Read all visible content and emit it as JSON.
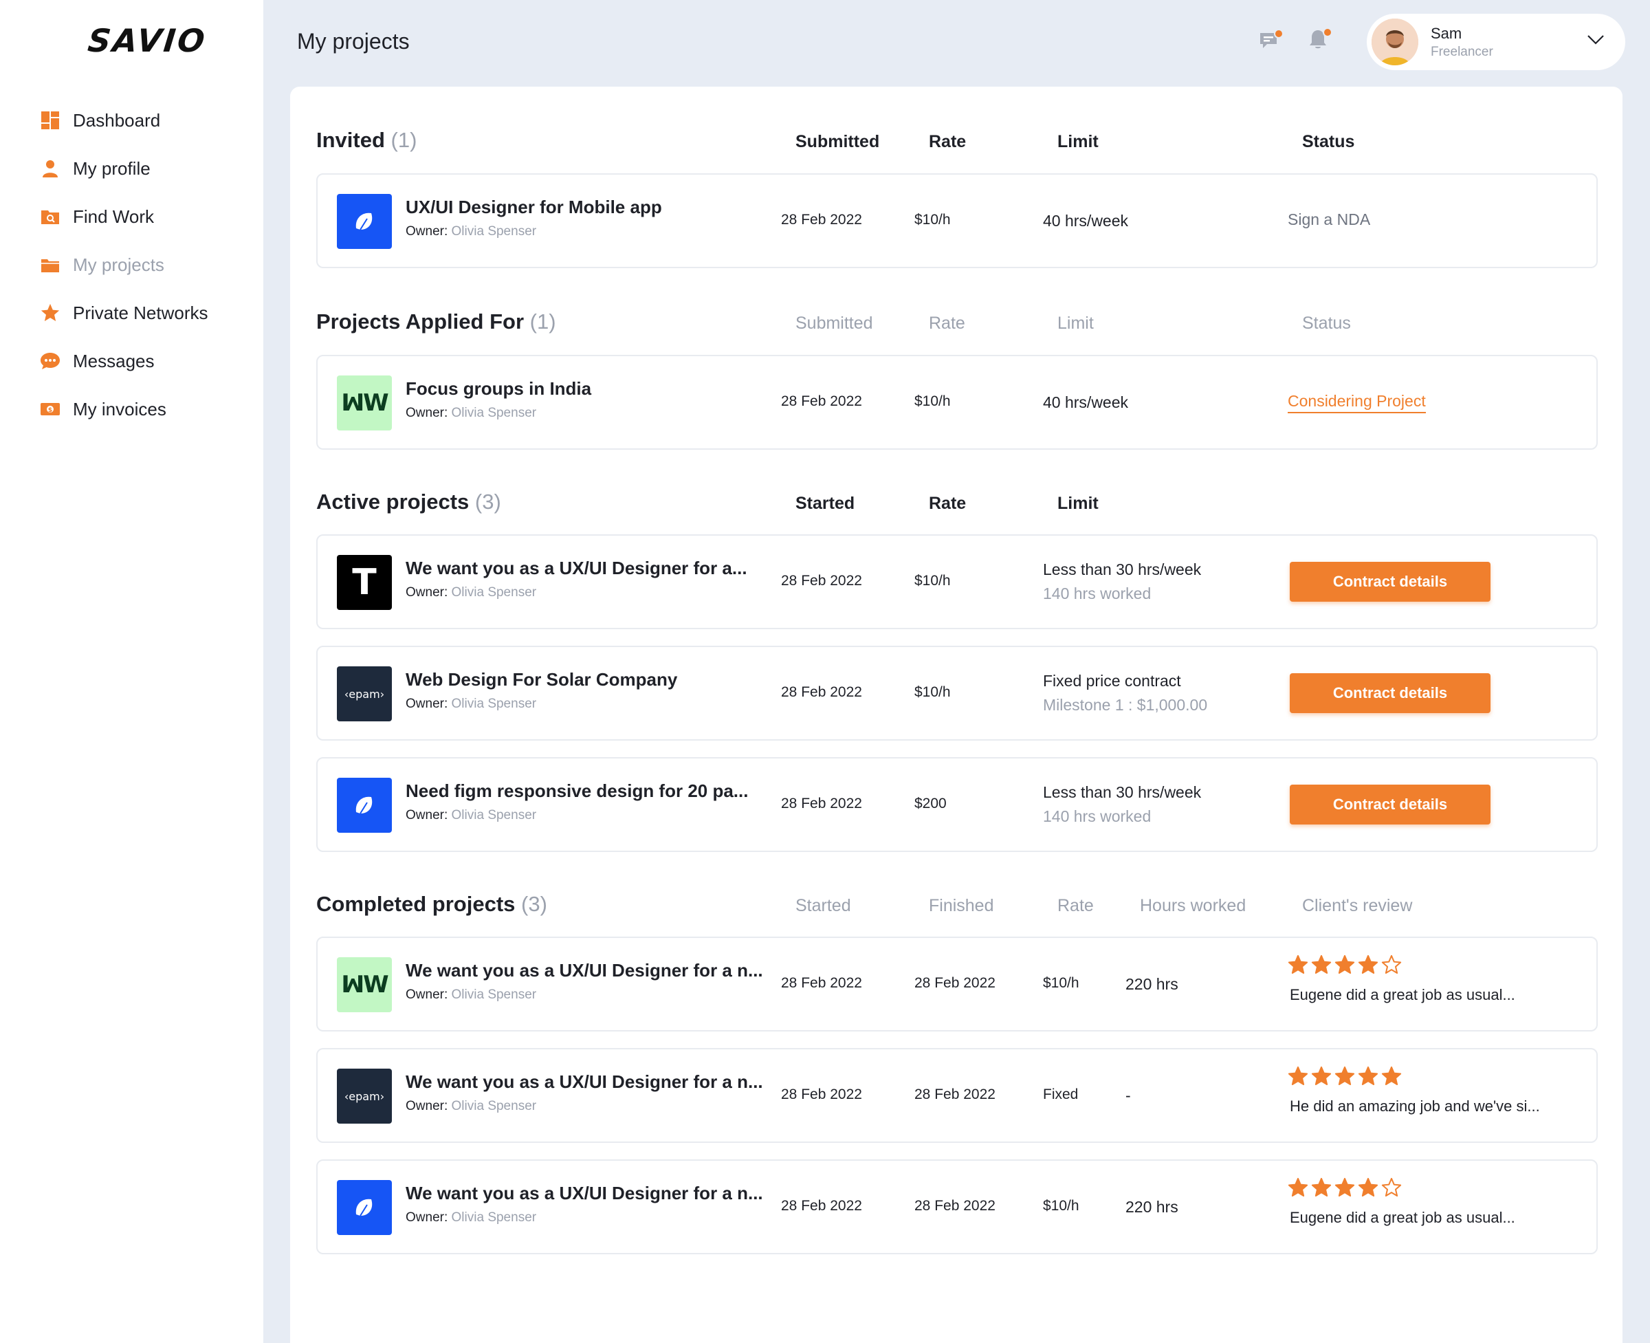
{
  "brand": {
    "logo": "SAVIO"
  },
  "sidebar": {
    "items": [
      {
        "label": "Dashboard",
        "icon": "dashboard-icon"
      },
      {
        "label": "My profile",
        "icon": "user-icon"
      },
      {
        "label": "Find Work",
        "icon": "find-work-icon"
      },
      {
        "label": "My projects",
        "icon": "folder-icon",
        "active": true
      },
      {
        "label": "Private Networks",
        "icon": "star-icon"
      },
      {
        "label": "Messages",
        "icon": "chat-icon"
      },
      {
        "label": "My invoices",
        "icon": "invoice-icon"
      }
    ]
  },
  "header": {
    "title": "My projects",
    "user": {
      "name": "Sam",
      "role": "Freelancer"
    }
  },
  "colors": {
    "accent": "#f07f2d",
    "muted": "#9ba1ad",
    "background": "#e7ecf4"
  },
  "sections": {
    "invited": {
      "title": "Invited",
      "count": "(1)",
      "columns": [
        "Submitted",
        "Rate",
        "Limit",
        "Status"
      ],
      "rows": [
        {
          "title": "UX/UI Designer for Mobile app",
          "owner_label": "Owner:",
          "owner": "Olivia Spenser",
          "date": "28 Feb 2022",
          "rate": "$10/h",
          "limit": "40 hrs/week",
          "status": "Sign a NDA",
          "logo": "blue-leaf"
        }
      ]
    },
    "applied": {
      "title": "Projects Applied For",
      "count": "(1)",
      "columns": [
        "Submitted",
        "Rate",
        "Limit",
        "Status"
      ],
      "rows": [
        {
          "title": "Focus groups in India",
          "owner_label": "Owner:",
          "owner": "Olivia Spenser",
          "date": "28 Feb 2022",
          "rate": "$10/h",
          "limit": "40 hrs/week",
          "status": "Considering Project",
          "logo": "green-w"
        }
      ]
    },
    "active": {
      "title": "Active projects",
      "count": "(3)",
      "columns": [
        "Started",
        "Rate",
        "Limit"
      ],
      "rows": [
        {
          "title": "We want you as a UX/UI Designer for a...",
          "owner_label": "Owner:",
          "owner": "Olivia Spenser",
          "date": "28 Feb 2022",
          "rate": "$10/h",
          "limit": "Less than 30 hrs/week",
          "limit_sub": "140 hrs worked",
          "button": "Contract details",
          "logo": "black-t"
        },
        {
          "title": "Web Design For Solar Company",
          "owner_label": "Owner:",
          "owner": "Olivia Spenser",
          "date": "28 Feb 2022",
          "rate": "$10/h",
          "limit": "Fixed price contract",
          "limit_sub": "Milestone 1 : $1,000.00",
          "button": "Contract details",
          "logo": "epam"
        },
        {
          "title": "Need figm responsive design for 20 pa...",
          "owner_label": "Owner:",
          "owner": "Olivia Spenser",
          "date": "28 Feb 2022",
          "rate": "$200",
          "limit": "Less than 30 hrs/week",
          "limit_sub": "140 hrs worked",
          "button": "Contract details",
          "logo": "blue-leaf"
        }
      ]
    },
    "completed": {
      "title": "Completed projects",
      "count": "(3)",
      "columns": [
        "Started",
        "Finished",
        "Rate",
        "Hours worked",
        "Client's review"
      ],
      "rows": [
        {
          "title": "We want you as a UX/UI Designer for a n...",
          "owner_label": "Owner:",
          "owner": "Olivia Spenser",
          "started": "28 Feb 2022",
          "finished": "28 Feb 2022",
          "rate": "$10/h",
          "hours": "220 hrs",
          "rating": 4,
          "review": "Eugene did a great job as usual...",
          "logo": "green-w"
        },
        {
          "title": "We want you as a UX/UI Designer for a n...",
          "owner_label": "Owner:",
          "owner": "Olivia Spenser",
          "started": "28 Feb 2022",
          "finished": "28 Feb 2022",
          "rate": "Fixed",
          "hours": "-",
          "rating": 5,
          "review": "He did an amazing job and we've si...",
          "logo": "epam"
        },
        {
          "title": "We want you as a UX/UI Designer for a n...",
          "owner_label": "Owner:",
          "owner": "Olivia Spenser",
          "started": "28 Feb 2022",
          "finished": "28 Feb 2022",
          "rate": "$10/h",
          "hours": "220 hrs",
          "rating": 4,
          "review": "Eugene did a great job as usual...",
          "logo": "blue-leaf"
        }
      ]
    }
  },
  "logo_texts": {
    "t": "T",
    "w": "ꟽW",
    "epam": "‹epam›"
  }
}
